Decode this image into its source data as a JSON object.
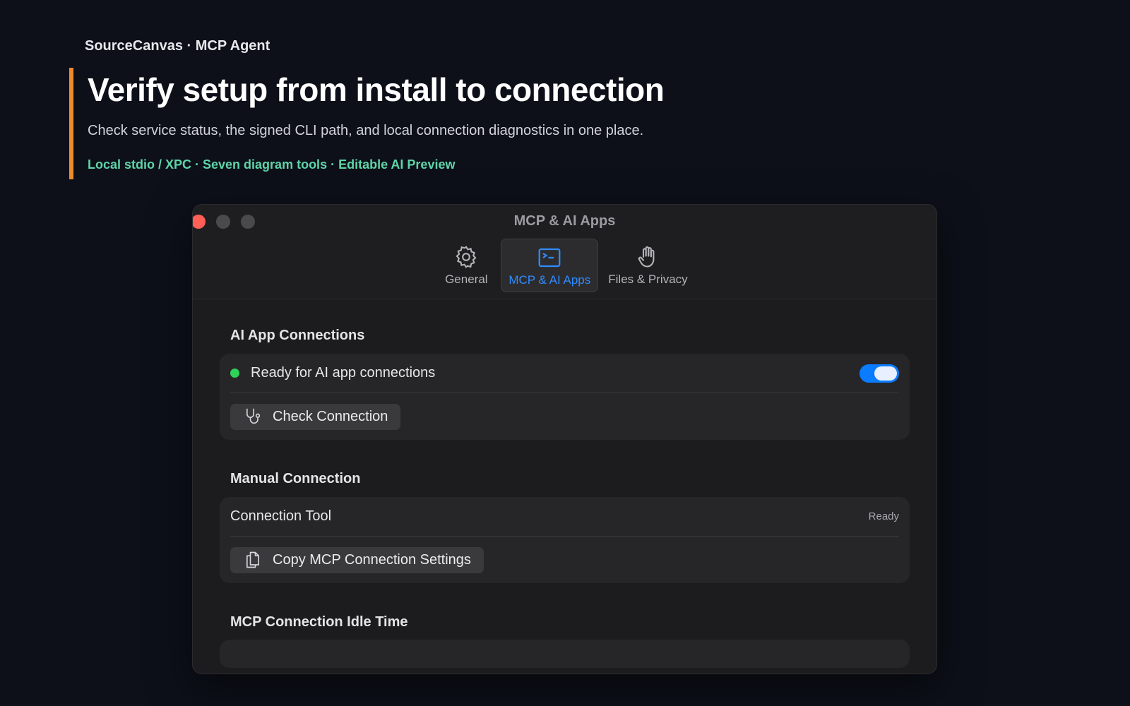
{
  "hero": {
    "eyebrow": "SourceCanvas · MCP Agent",
    "headline": "Verify setup from install to connection",
    "subtitle": "Check service status, the signed CLI path, and local connection diagnostics in one place.",
    "tags": "Local stdio / XPC · Seven diagram tools · Editable AI Preview"
  },
  "window": {
    "title": "MCP & AI Apps",
    "tabs": [
      {
        "label": "General",
        "icon": "gear-icon"
      },
      {
        "label": "MCP & AI Apps",
        "icon": "terminal-icon"
      },
      {
        "label": "Files & Privacy",
        "icon": "hand-icon"
      }
    ],
    "active_tab": "MCP & AI Apps"
  },
  "sections": {
    "ai_connections": {
      "title": "AI App Connections",
      "status_label": "Ready for AI app connections",
      "status_color": "#30d158",
      "toggle_on": true,
      "check_button": "Check Connection"
    },
    "manual_connection": {
      "title": "Manual Connection",
      "tool_label": "Connection Tool",
      "tool_status": "Ready",
      "copy_button": "Copy MCP Connection Settings"
    },
    "idle_time": {
      "title": "MCP Connection Idle Time"
    }
  },
  "colors": {
    "accent_bar": "#f08a2c",
    "tag_green": "#5fd4a8",
    "active_tab_blue": "#2f8cff",
    "toggle_blue": "#0a7cff"
  }
}
